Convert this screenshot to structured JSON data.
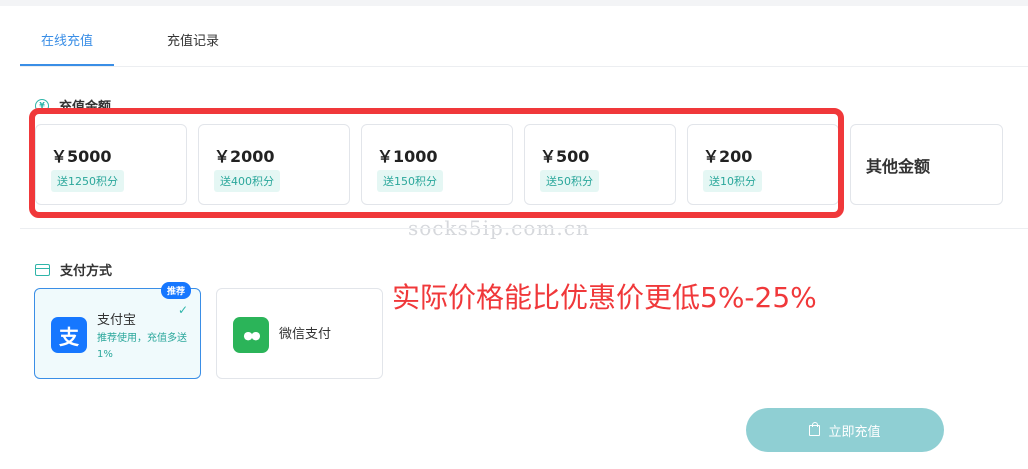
{
  "tabs": [
    {
      "label": "在线充值",
      "active": true
    },
    {
      "label": "充值记录",
      "active": false
    }
  ],
  "amount_section": {
    "title": "充值金额",
    "icon": "yen-circle-icon",
    "options": [
      {
        "amount": "￥5000",
        "bonus": "送1250积分"
      },
      {
        "amount": "￥2000",
        "bonus": "送400积分"
      },
      {
        "amount": "￥1000",
        "bonus": "送150积分"
      },
      {
        "amount": "￥500",
        "bonus": "送50积分"
      },
      {
        "amount": "￥200",
        "bonus": "送10积分"
      }
    ],
    "other_label": "其他金额"
  },
  "watermark": "socks5ip.com.cn",
  "payment_section": {
    "title": "支付方式",
    "icon": "card-icon",
    "methods": [
      {
        "name": "支付宝",
        "icon_glyph": "支",
        "desc": "推荐使用，充值多送1%",
        "badge": "推荐",
        "selected": true
      },
      {
        "name": "微信支付",
        "icon_glyph": "●●",
        "selected": false
      }
    ]
  },
  "promo_text": "实际价格能比优惠价更低5%-25%",
  "submit_label": "立即充值",
  "colors": {
    "accent": "#3a8ee6",
    "teal": "#2fb5a9",
    "highlight_red": "#f0383a",
    "alipay_blue": "#1677ff",
    "wechat_green": "#2bb459",
    "button": "#8fcfd3"
  }
}
